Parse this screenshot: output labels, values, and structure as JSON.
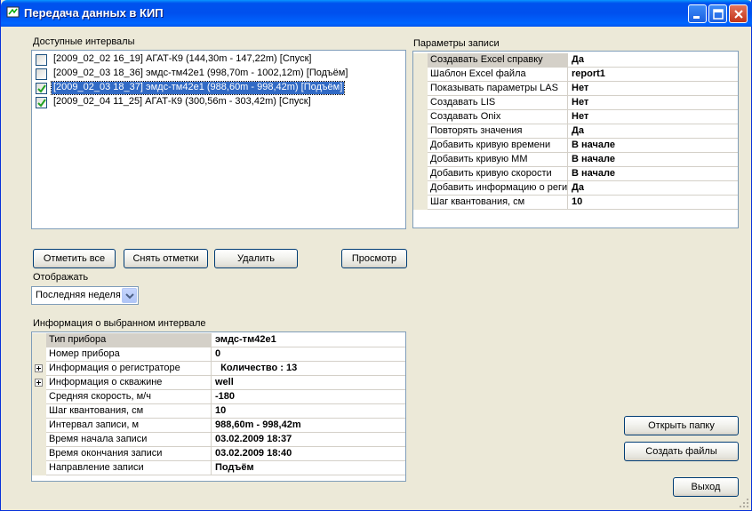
{
  "window": {
    "title": "Передача данных в КИП",
    "icons": {
      "app": "app-icon",
      "minimize": "minimize-icon",
      "maximize": "maximize-icon",
      "close": "close-icon"
    }
  },
  "intervals": {
    "label": "Доступные интервалы",
    "items": [
      {
        "text": "[2009_02_02  16_19]  АГАТ-К9 (144,30m - 147,22m)  [Спуск]",
        "checked": false,
        "selected": false
      },
      {
        "text": "[2009_02_03  18_36]  эмдс-тм42е1 (998,70m - 1002,12m)  [Подъём]",
        "checked": false,
        "selected": false
      },
      {
        "text": "[2009_02_03  18_37]  эмдс-тм42е1 (988,60m - 998,42m)  [Подъём]",
        "checked": true,
        "selected": true
      },
      {
        "text": "[2009_02_04  11_25]  АГАТ-К9 (300,56m - 303,42m)  [Спуск]",
        "checked": true,
        "selected": false
      }
    ]
  },
  "buttons": {
    "check_all": "Отметить все",
    "uncheck": "Снять отметки",
    "delete": "Удалить",
    "preview": "Просмотр",
    "open_folder": "Открыть папку",
    "create_files": "Создать файлы",
    "exit": "Выход"
  },
  "display": {
    "label": "Отображать",
    "selected": "Последняя неделя"
  },
  "record_params": {
    "label": "Параметры записи",
    "rows": [
      {
        "name": "Создавать Excel справку",
        "value": "Да"
      },
      {
        "name": "Шаблон Excel файла",
        "value": "report1"
      },
      {
        "name": "Показывать параметры LAS",
        "value": "Нет"
      },
      {
        "name": "Создавать LIS",
        "value": "Нет"
      },
      {
        "name": "Создавать Onix",
        "value": "Нет"
      },
      {
        "name": "Повторять значения",
        "value": "Да"
      },
      {
        "name": "Добавить кривую времени",
        "value": "В начале"
      },
      {
        "name": "Добавить кривую ММ",
        "value": "В начале"
      },
      {
        "name": "Добавить кривую скорости",
        "value": "В начале"
      },
      {
        "name": "Добавить информацию о реги",
        "value": "Да"
      },
      {
        "name": "Шаг квантования, см",
        "value": "10"
      }
    ]
  },
  "interval_info": {
    "label": "Информация о выбранном интервале",
    "rows": [
      {
        "name": "Тип прибора",
        "value": "эмдс-тм42е1",
        "expandable": false
      },
      {
        "name": "Номер прибора",
        "value": "0",
        "expandable": false
      },
      {
        "name": "Информация о регистраторе",
        "value": "  Количество : 13",
        "expandable": true
      },
      {
        "name": "Информация о скважине",
        "value": "well",
        "expandable": true
      },
      {
        "name": "Средняя скорость, м/ч",
        "value": "-180",
        "expandable": false
      },
      {
        "name": "Шаг квантования, см",
        "value": "10",
        "expandable": false
      },
      {
        "name": "Интервал записи, м",
        "value": "988,60m - 998,42m",
        "expandable": false
      },
      {
        "name": "Время начала записи",
        "value": "03.02.2009 18:37",
        "expandable": false
      },
      {
        "name": "Время окончания записи",
        "value": "03.02.2009 18:40",
        "expandable": false
      },
      {
        "name": "Направление записи",
        "value": "Подъём",
        "expandable": false
      }
    ]
  },
  "colors": {
    "selection": "#316ac5",
    "title_bar": "#0054e3",
    "face": "#ece9d8"
  }
}
